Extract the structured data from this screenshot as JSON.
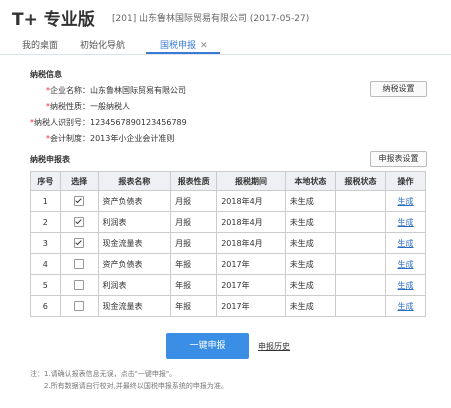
{
  "header": {
    "logo_mark": "T+",
    "logo_text": "专业版",
    "company_info": "[201]  山东鲁林国际贸易有限公司  (2017-05-27)"
  },
  "tabs": [
    {
      "label": "我的桌面"
    },
    {
      "label": "初始化导航"
    },
    {
      "label": "国税申报",
      "close": "✕"
    }
  ],
  "tax_info": {
    "title": "纳税信息",
    "rows": [
      {
        "label": "企业名称：",
        "value": "山东鲁林国际贸易有限公司"
      },
      {
        "label": "纳税性质：",
        "value": "一般纳税人"
      },
      {
        "label": "纳税人识别号：",
        "value": "1234567890123456789"
      },
      {
        "label": "会计制度：",
        "value": "2013年小企业会计准则"
      }
    ],
    "settings_button": "纳税设置"
  },
  "report": {
    "title": "纳税申报表",
    "settings_button": "申报表设置",
    "columns": [
      "序号",
      "选择",
      "报表名称",
      "报表性质",
      "报税期间",
      "本地状态",
      "报税状态",
      "操作"
    ],
    "rows": [
      {
        "index": "1",
        "checked": true,
        "name": "资产负债表",
        "type": "月报",
        "period": "2018年4月",
        "local_status": "未生成",
        "tax_status": "",
        "action": "生成"
      },
      {
        "index": "2",
        "checked": true,
        "name": "利润表",
        "type": "月报",
        "period": "2018年4月",
        "local_status": "未生成",
        "tax_status": "",
        "action": "生成"
      },
      {
        "index": "3",
        "checked": true,
        "name": "现金流量表",
        "type": "月报",
        "period": "2018年4月",
        "local_status": "未生成",
        "tax_status": "",
        "action": "生成"
      },
      {
        "index": "4",
        "checked": false,
        "name": "资产负债表",
        "type": "年报",
        "period": "2017年",
        "local_status": "未生成",
        "tax_status": "",
        "action": "生成"
      },
      {
        "index": "5",
        "checked": false,
        "name": "利润表",
        "type": "年报",
        "period": "2017年",
        "local_status": "未生成",
        "tax_status": "",
        "action": "生成"
      },
      {
        "index": "6",
        "checked": false,
        "name": "现金流量表",
        "type": "年报",
        "period": "2017年",
        "local_status": "未生成",
        "tax_status": "",
        "action": "生成"
      }
    ]
  },
  "actions": {
    "submit": "一键申报",
    "history": "申报历史"
  },
  "notes": [
    "注：1.请确认报表信息无误，点击\"一键申报\"。",
    "2.所有数据请自行校对,并最终以国税申报系统的申报为准。"
  ]
}
